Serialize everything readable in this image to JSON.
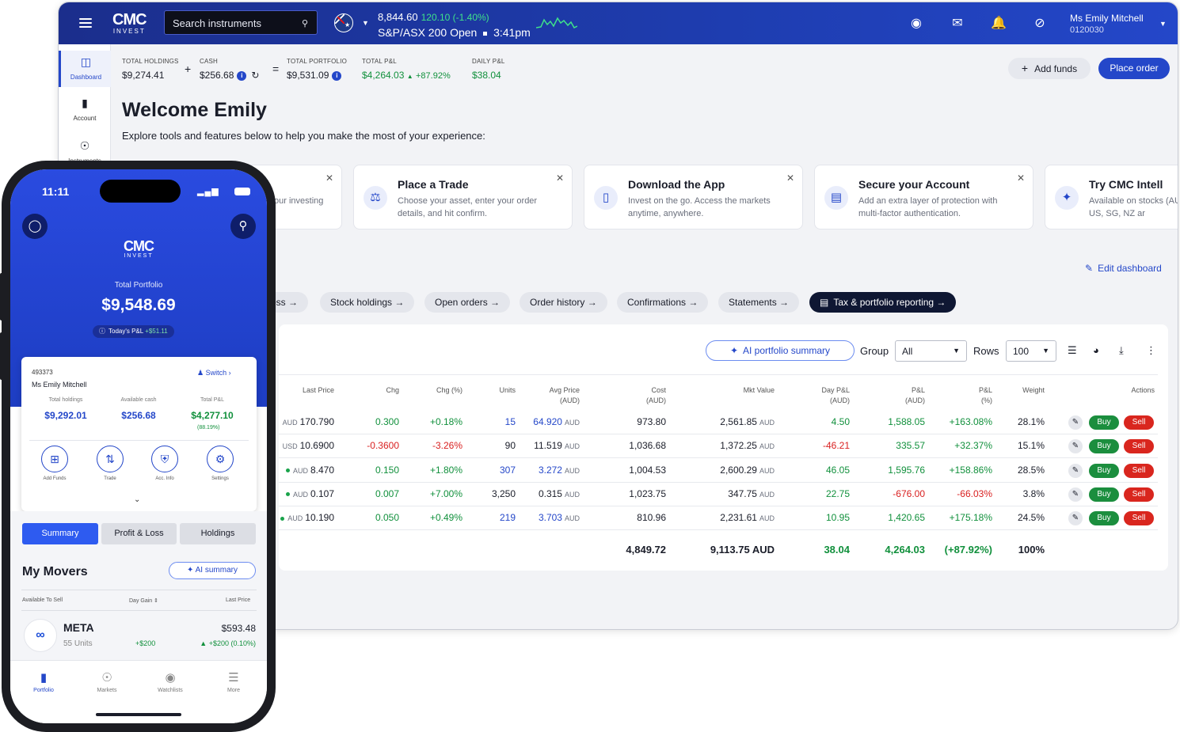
{
  "topbar": {
    "logo_main": "CMC",
    "logo_sub": "INVEST",
    "search_placeholder": "Search instruments",
    "index_value": "8,844.60",
    "index_change": "120.10 (-1.40%)",
    "index_name": "S&P/ASX 200",
    "market_status": "Open",
    "market_time": "3:41pm",
    "user_name": "Ms Emily Mitchell",
    "user_id": "0120030"
  },
  "sidebar": {
    "items": [
      {
        "label": "Dashboard",
        "icon": "dashboard-icon"
      },
      {
        "label": "Account",
        "icon": "bar-chart-icon"
      },
      {
        "label": "Instruments",
        "icon": "globe-icon"
      }
    ]
  },
  "summary": {
    "holdings_label": "TOTAL HOLDINGS",
    "holdings_value": "$9,274.41",
    "cash_label": "CASH",
    "cash_value": "$256.68",
    "portfolio_label": "TOTAL PORTFOLIO",
    "portfolio_value": "$9,531.09",
    "pnl_label": "TOTAL P&L",
    "pnl_value": "$4,264.03",
    "pnl_pct": "+87.92%",
    "daily_label": "DAILY P&L",
    "daily_value": "$38.04",
    "add_funds": "Add funds",
    "place_order": "Place order"
  },
  "welcome": {
    "title": "Welcome Emily",
    "subtitle": "Explore tools and features below to help you make the most of your experience:"
  },
  "cards": [
    {
      "title": "",
      "desc": "our investing",
      "icon": "star-icon"
    },
    {
      "title": "Place a Trade",
      "desc": "Choose your asset, enter your order details, and hit confirm.",
      "icon": "trade-icon"
    },
    {
      "title": "Download the App",
      "desc": "Invest on the go. Access the markets anytime, anywhere.",
      "icon": "phone-icon"
    },
    {
      "title": "Secure your Account",
      "desc": "Add an extra layer of protection with multi-factor authentication.",
      "icon": "document-lock-icon"
    },
    {
      "title": "Try CMC Intell",
      "desc": "Available on stocks (AU, US, SG, NZ ar",
      "icon": "sparkle-icon"
    }
  ],
  "edit_dashboard": "Edit dashboard",
  "pills": [
    "oss",
    "Stock holdings",
    "Open orders",
    "Order history",
    "Confirmations",
    "Statements",
    "Tax & portfolio reporting"
  ],
  "table": {
    "ai_summary": "AI portfolio summary",
    "group_label": "Group",
    "group_value": "All",
    "rows_label": "Rows",
    "rows_value": "100",
    "headers": {
      "last": "Last Price",
      "chg": "Chg",
      "chgpct": "Chg (%)",
      "units": "Units",
      "avg": "Avg Price",
      "avg_u": "(AUD)",
      "cost": "Cost",
      "cost_u": "(AUD)",
      "mkt": "Mkt Value",
      "day": "Day P&L",
      "day_u": "(AUD)",
      "pnl": "P&L",
      "pnl_u": "(AUD)",
      "pnlpct": "P&L",
      "pnlpct_u": "(%)",
      "weight": "Weight",
      "actions": "Actions"
    },
    "rows": [
      {
        "cur": "AUD",
        "last": "170.790",
        "chg": "0.300",
        "chgpct": "+0.18%",
        "units": "15",
        "avg": "64.920",
        "avg_cur": "AUD",
        "cost": "973.80",
        "mkt": "2,561.85",
        "mkt_cur": "AUD",
        "day": "4.50",
        "pnl": "1,588.05",
        "pnlpct": "+163.08%",
        "weight": "28.1%",
        "dot": false,
        "neg": false
      },
      {
        "cur": "USD",
        "last": "10.6900",
        "chg": "-0.3600",
        "chgpct": "-3.26%",
        "units": "90",
        "avg": "11.519",
        "avg_cur": "AUD",
        "cost": "1,036.68",
        "mkt": "1,372.25",
        "mkt_cur": "AUD",
        "day": "-46.21",
        "pnl": "335.57",
        "pnlpct": "+32.37%",
        "weight": "15.1%",
        "dot": false,
        "neg": true
      },
      {
        "cur": "AUD",
        "last": "8.470",
        "chg": "0.150",
        "chgpct": "+1.80%",
        "units": "307",
        "avg": "3.272",
        "avg_cur": "AUD",
        "cost": "1,004.53",
        "mkt": "2,600.29",
        "mkt_cur": "AUD",
        "day": "46.05",
        "pnl": "1,595.76",
        "pnlpct": "+158.86%",
        "weight": "28.5%",
        "dot": true,
        "neg": false
      },
      {
        "cur": "AUD",
        "last": "0.107",
        "chg": "0.007",
        "chgpct": "+7.00%",
        "units": "3,250",
        "avg": "0.315",
        "avg_cur": "AUD",
        "cost": "1,023.75",
        "mkt": "347.75",
        "mkt_cur": "AUD",
        "day": "22.75",
        "pnl": "-676.00",
        "pnlpct": "-66.03%",
        "weight": "3.8%",
        "dot": true,
        "neg": false
      },
      {
        "cur": "AUD",
        "last": "10.190",
        "chg": "0.050",
        "chgpct": "+0.49%",
        "units": "219",
        "avg": "3.703",
        "avg_cur": "AUD",
        "cost": "810.96",
        "mkt": "2,231.61",
        "mkt_cur": "AUD",
        "day": "10.95",
        "pnl": "1,420.65",
        "pnlpct": "+175.18%",
        "weight": "24.5%",
        "dot": true,
        "neg": false
      }
    ],
    "totals": {
      "cost": "4,849.72",
      "mkt": "9,113.75 AUD",
      "day": "38.04",
      "pnl": "4,264.03",
      "pnlpct": "(+87.92%)",
      "weight": "100%"
    },
    "buy": "Buy",
    "sell": "Sell"
  },
  "phone": {
    "time": "11:11",
    "logo_main": "CMC",
    "logo_sub": "INVEST",
    "portfolio_label": "Total Portfolio",
    "portfolio_value": "$9,548.69",
    "today_label": "Today's P&L",
    "today_value": "+$51.11",
    "account_id": "493373",
    "account_name": "Ms Emily Mitchell",
    "switch": "Switch",
    "holdings_label": "Total holdings",
    "holdings_value": "$9,292.01",
    "cash_label": "Available cash",
    "cash_value": "$256.68",
    "pnl_label": "Total P&L",
    "pnl_value": "$4,277.10",
    "pnl_pct": "(88.19%)",
    "actions": [
      "Add Funds",
      "Trade",
      "Acc. Info",
      "Settings"
    ],
    "tabs": [
      "Summary",
      "Profit & Loss",
      "Holdings"
    ],
    "movers_title": "My Movers",
    "ai_summary": "AI summary",
    "col_sell": "Available To Sell",
    "col_gain": "Day Gain",
    "col_last": "Last Price",
    "mover": {
      "name": "META",
      "units": "55 Units",
      "gain": "+$200",
      "price": "$593.48",
      "change": "+$200 (0.10%)"
    },
    "nav": [
      "Portfolio",
      "Markets",
      "Watchlists",
      "More"
    ]
  }
}
